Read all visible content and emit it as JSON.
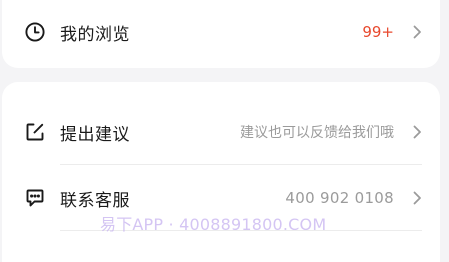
{
  "history": {
    "label": "我的浏览",
    "count": "99+",
    "icon": "clock-icon"
  },
  "feedback": {
    "label": "提出建议",
    "hint": "建议也可以反馈给我们哦",
    "icon": "edit-icon"
  },
  "service": {
    "label": "联系客服",
    "phone": "400 902 0108",
    "icon": "chat-icon"
  },
  "watermark": "易下APP · 4008891800.COM",
  "colors": {
    "background": "#f4f4f6",
    "card": "#ffffff",
    "badge": "#e8492e",
    "muted": "#9b9b9b",
    "watermark": "#cdbbf2"
  }
}
